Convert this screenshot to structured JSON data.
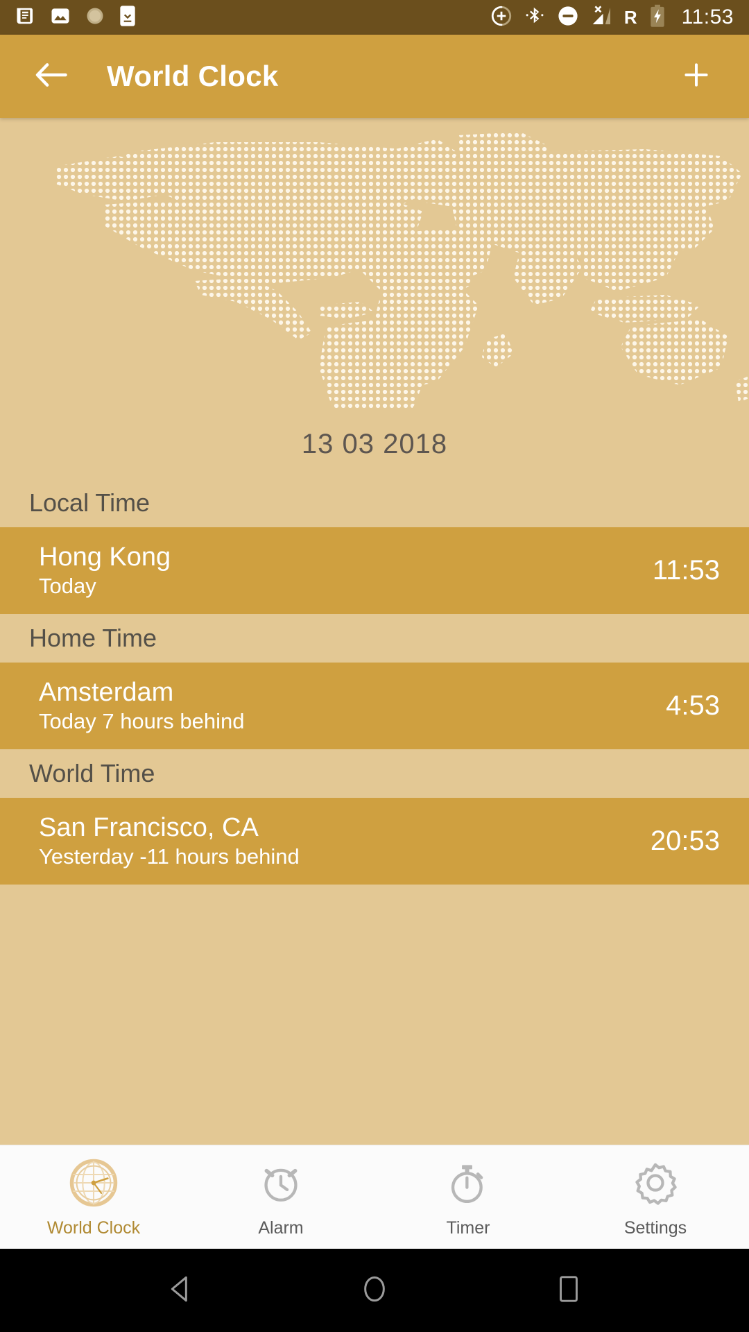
{
  "status_bar": {
    "time": "11:53",
    "roaming_label": "R",
    "left_icons": [
      "news-icon",
      "image-icon",
      "sun-brightness-icon",
      "download-to-phone-icon"
    ],
    "right_icons": [
      "location-add-icon",
      "bluetooth-icon",
      "do-not-disturb-icon",
      "signal-no-service-icon",
      "roaming-icon",
      "battery-charging-icon"
    ],
    "background_color": "#6b4f1d"
  },
  "appbar": {
    "title": "World Clock",
    "back_icon": "arrow-left-icon",
    "add_icon": "plus-icon",
    "background_color": "#cfa040"
  },
  "main": {
    "map_icon": "dotted-world-map",
    "date": "13 03 2018",
    "sections": [
      {
        "header": "Local Time",
        "city": "Hong Kong",
        "subtitle": "Today",
        "time": "11:53"
      },
      {
        "header": "Home Time",
        "city": "Amsterdam",
        "subtitle": "Today  7 hours behind",
        "time": "4:53"
      },
      {
        "header": "World Time",
        "city": "San Francisco, CA",
        "subtitle": "Yesterday -11 hours behind",
        "time": "20:53"
      }
    ]
  },
  "tabbar": {
    "items": [
      {
        "label": "World Clock",
        "icon": "globe-clock-icon",
        "active": true
      },
      {
        "label": "Alarm",
        "icon": "alarm-clock-icon",
        "active": false
      },
      {
        "label": "Timer",
        "icon": "stopwatch-icon",
        "active": false
      },
      {
        "label": "Settings",
        "icon": "gear-icon",
        "active": false
      }
    ],
    "active_color": "#b08a33",
    "inactive_color": "#b7b7b7"
  },
  "navbar": {
    "back_icon": "triangle-back-icon",
    "home_icon": "circle-home-icon",
    "recents_icon": "square-recents-icon"
  },
  "theme": {
    "background": "#e3c894",
    "accent": "#cfa040",
    "statusbar": "#6b4f1d",
    "map_dot": "#fdf6e8"
  }
}
